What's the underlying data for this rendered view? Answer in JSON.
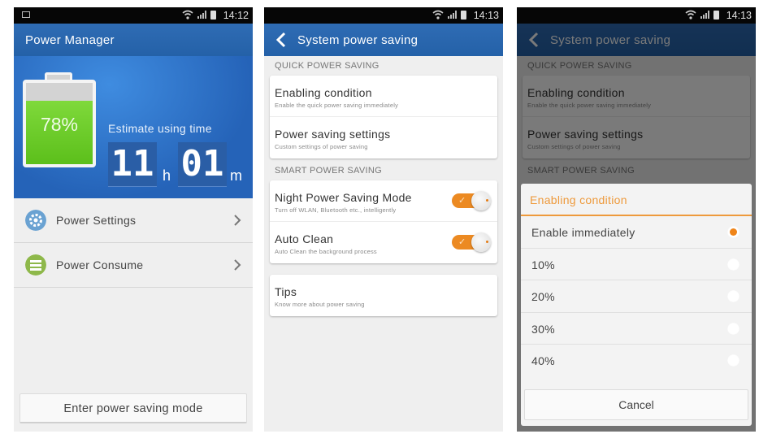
{
  "screens": [
    {
      "status_time": "14:12",
      "title": "Power Manager",
      "battery_percent": "78%",
      "battery_level": 0.78,
      "estimate_label": "Estimate using time",
      "hours": "11",
      "hours_unit": "h",
      "minutes": "01",
      "minutes_unit": "m",
      "menu": [
        {
          "label": "Power Settings",
          "icon": "gear-icon",
          "color": "#6aa2d2"
        },
        {
          "label": "Power Consume",
          "icon": "list-icon",
          "color": "#8eb84a"
        }
      ],
      "enter_button": "Enter power saving mode"
    },
    {
      "status_time": "14:13",
      "title": "System power saving",
      "sections": [
        {
          "header": "QUICK POWER SAVING",
          "rows": [
            {
              "title": "Enabling condition",
              "subtitle": "Enable the quick power saving immediately"
            },
            {
              "title": "Power saving settings",
              "subtitle": "Custom settings of power saving"
            }
          ]
        },
        {
          "header": "SMART POWER SAVING",
          "rows": [
            {
              "title": "Night Power Saving Mode",
              "subtitle": "Turn off WLAN, Bluetooth etc., intelligently",
              "toggle": true
            },
            {
              "title": "Auto Clean",
              "subtitle": "Auto Clean the background process",
              "toggle": true
            }
          ]
        }
      ],
      "tips": {
        "title": "Tips",
        "subtitle": "Know more about power saving"
      }
    },
    {
      "status_time": "14:13",
      "dialog": {
        "title": "Enabling condition",
        "options": [
          "Enable immediately",
          "10%",
          "20%",
          "30%",
          "40%"
        ],
        "selected_index": 0,
        "cancel": "Cancel"
      }
    }
  ],
  "colors": {
    "accent_orange": "#ec8a22",
    "appbar_blue": "#2a65ad",
    "battery_green": "#6fcd2b"
  }
}
